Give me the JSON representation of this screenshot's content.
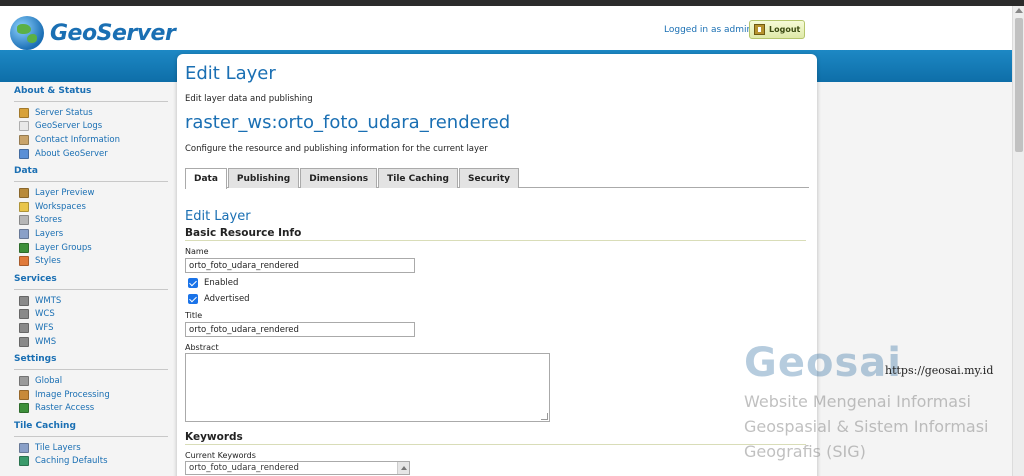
{
  "header": {
    "logo_text": "GeoServer",
    "login_text": "Logged in as admin.",
    "logout_label": "Logout"
  },
  "sidebar": {
    "sections": [
      {
        "title": "About & Status",
        "items": [
          {
            "label": "Server Status",
            "icon": "server-status-icon",
            "color": "#d8a23a"
          },
          {
            "label": "GeoServer Logs",
            "icon": "logs-icon",
            "color": "#e8e8e8"
          },
          {
            "label": "Contact Information",
            "icon": "contact-icon",
            "color": "#c9a46b"
          },
          {
            "label": "About GeoServer",
            "icon": "about-icon",
            "color": "#5a8fd6"
          }
        ]
      },
      {
        "title": "Data",
        "items": [
          {
            "label": "Layer Preview",
            "icon": "layer-preview-icon",
            "color": "#b88a3a"
          },
          {
            "label": "Workspaces",
            "icon": "workspaces-icon",
            "color": "#e9c54a"
          },
          {
            "label": "Stores",
            "icon": "stores-icon",
            "color": "#b6b6b6"
          },
          {
            "label": "Layers",
            "icon": "layers-icon",
            "color": "#8aa0c8"
          },
          {
            "label": "Layer Groups",
            "icon": "layer-groups-icon",
            "color": "#3d8f3a"
          },
          {
            "label": "Styles",
            "icon": "styles-icon",
            "color": "#e07a3a"
          }
        ]
      },
      {
        "title": "Services",
        "items": [
          {
            "label": "WMTS",
            "icon": "wmts-icon",
            "color": "#8a8a8a"
          },
          {
            "label": "WCS",
            "icon": "wcs-icon",
            "color": "#8a8a8a"
          },
          {
            "label": "WFS",
            "icon": "wfs-icon",
            "color": "#8a8a8a"
          },
          {
            "label": "WMS",
            "icon": "wms-icon",
            "color": "#8a8a8a"
          }
        ]
      },
      {
        "title": "Settings",
        "items": [
          {
            "label": "Global",
            "icon": "global-icon",
            "color": "#9a9a9a"
          },
          {
            "label": "Image Processing",
            "icon": "image-processing-icon",
            "color": "#c88a3a"
          },
          {
            "label": "Raster Access",
            "icon": "raster-access-icon",
            "color": "#3d8f3a"
          }
        ]
      },
      {
        "title": "Tile Caching",
        "items": [
          {
            "label": "Tile Layers",
            "icon": "tile-layers-icon",
            "color": "#8aa0c8"
          },
          {
            "label": "Caching Defaults",
            "icon": "caching-defaults-icon",
            "color": "#3a9a6a"
          }
        ]
      }
    ]
  },
  "main": {
    "page_title": "Edit Layer",
    "page_desc": "Edit layer data and publishing",
    "layer_name": "raster_ws:orto_foto_udara_rendered",
    "layer_desc": "Configure the resource and publishing information for the current layer",
    "tabs": [
      {
        "label": "Data",
        "active": true
      },
      {
        "label": "Publishing",
        "active": false
      },
      {
        "label": "Dimensions",
        "active": false
      },
      {
        "label": "Tile Caching",
        "active": false
      },
      {
        "label": "Security",
        "active": false
      }
    ],
    "sub_title": "Edit Layer",
    "basic_info_title": "Basic Resource Info",
    "name_label": "Name",
    "name_value": "orto_foto_udara_rendered",
    "enabled_label": "Enabled",
    "enabled_checked": true,
    "advertised_label": "Advertised",
    "advertised_checked": true,
    "title_label": "Title",
    "title_value": "orto_foto_udara_rendered",
    "abstract_label": "Abstract",
    "abstract_value": "",
    "keywords_title": "Keywords",
    "current_keywords_label": "Current Keywords",
    "current_keyword": "orto_foto_udara_rendered"
  },
  "watermark": {
    "brand": "Geosai",
    "url": "https://geosai.my.id",
    "line1": "Website Mengenai Informasi",
    "line2": "Geospasial & Sistem Informasi",
    "line3": "Geografis (SIG)"
  }
}
